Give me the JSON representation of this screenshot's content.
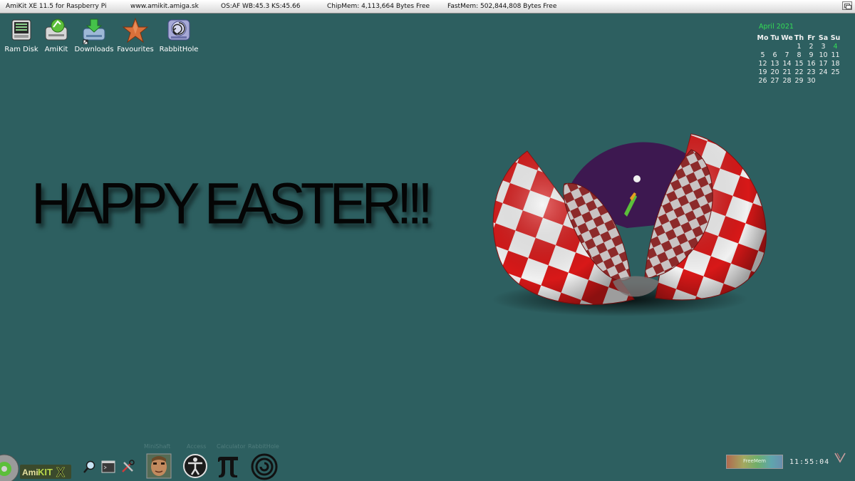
{
  "titlebar": {
    "app": "AmiKit XE 11.5 for Raspberry Pi",
    "url": "www.amikit.amiga.sk",
    "versions": "OS:AF  WB:45.3  KS:45.66",
    "chipmem": "ChipMem: 4,113,664 Bytes Free",
    "fastmem": "FastMem: 502,844,808 Bytes Free"
  },
  "desktop_icons": [
    {
      "label": "Ram Disk",
      "icon": "ram-disk-icon"
    },
    {
      "label": "AmiKit",
      "icon": "amikit-drive-icon"
    },
    {
      "label": "Downloads",
      "icon": "downloads-icon"
    },
    {
      "label": "Favourites",
      "icon": "star-icon"
    },
    {
      "label": "RabbitHole",
      "icon": "rabbithole-drive-icon"
    }
  ],
  "calendar": {
    "month_year": "April  2021",
    "weekdays": [
      "Mo",
      "Tu",
      "We",
      "Th",
      "Fr",
      "Sa",
      "Su"
    ],
    "today": "4",
    "colors": {
      "title": "#33dd55",
      "today": "#33dd55"
    }
  },
  "greeting": "HAPPY EASTER!!!",
  "dock": {
    "labels": {
      "mineshaft": "MiniShaft",
      "access": "Access",
      "calc": "Calculator",
      "rabbithole": "RabbitHole"
    }
  },
  "memgauge": {
    "label": "FreeMem"
  },
  "clock": "11:55:04",
  "colors": {
    "desktop": "#2d5f60",
    "accent_green": "#33dd55",
    "boing_red": "#d81818"
  }
}
